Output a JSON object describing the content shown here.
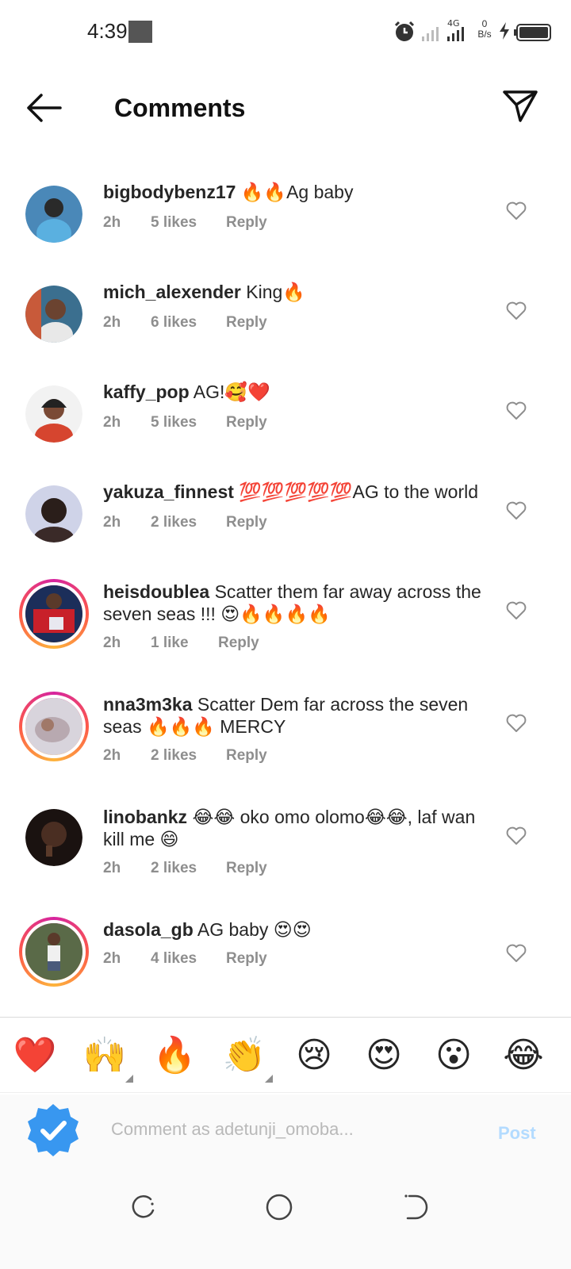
{
  "status": {
    "time": "4:39",
    "network": "4G",
    "net_speed_value": "0",
    "net_speed_unit": "B/s"
  },
  "header": {
    "title": "Comments"
  },
  "comments": [
    {
      "username": "bigbodybenz17",
      "text": "🔥🔥Ag baby",
      "time": "2h",
      "likes": "5 likes",
      "reply": "Reply",
      "story_ring": false
    },
    {
      "username": "mich_alexender",
      "text": "King🔥",
      "time": "2h",
      "likes": "6 likes",
      "reply": "Reply",
      "story_ring": false
    },
    {
      "username": "kaffy_pop",
      "text": "AG!🥰❤️",
      "time": "2h",
      "likes": "5 likes",
      "reply": "Reply",
      "story_ring": false
    },
    {
      "username": "yakuza_finnest",
      "text": "💯💯💯💯💯AG to the world",
      "time": "2h",
      "likes": "2 likes",
      "reply": "Reply",
      "story_ring": false
    },
    {
      "username": "heisdoublea",
      "text": "Scatter them far away across the seven seas !!! 😍🔥🔥🔥🔥",
      "time": "2h",
      "likes": "1 like",
      "reply": "Reply",
      "story_ring": true
    },
    {
      "username": "nna3m3ka",
      "text": "Scatter Dem far across the seven seas 🔥🔥🔥 MERCY",
      "time": "2h",
      "likes": "2 likes",
      "reply": "Reply",
      "story_ring": true
    },
    {
      "username": "linobankz",
      "text": "😂😂 oko omo olomo😂😂, laf wan kill me 😄",
      "time": "2h",
      "likes": "2 likes",
      "reply": "Reply",
      "story_ring": false
    },
    {
      "username": "dasola_gb",
      "text": "AG baby 😍😍",
      "time": "2h",
      "likes": "4 likes",
      "reply": "Reply",
      "story_ring": true
    }
  ],
  "emoji_bar": [
    {
      "glyph": "❤️",
      "icon": "red-heart-icon"
    },
    {
      "glyph": "🙌",
      "icon": "raising-hands-icon"
    },
    {
      "glyph": "🔥",
      "icon": "fire-icon"
    },
    {
      "glyph": "👏",
      "icon": "clapping-hands-icon"
    },
    {
      "glyph": "😢",
      "icon": "crying-face-icon"
    },
    {
      "glyph": "😍",
      "icon": "heart-eyes-icon"
    },
    {
      "glyph": "😮",
      "icon": "surprised-face-icon"
    },
    {
      "glyph": "😂",
      "icon": "tears-of-joy-icon"
    }
  ],
  "composer": {
    "placeholder": "Comment as adetunji_omoba...",
    "post_label": "Post"
  },
  "colors": {
    "post_disabled": "#b3dbff",
    "meta_gray": "#8e8e8e",
    "verified_blue": "#3897f0"
  }
}
